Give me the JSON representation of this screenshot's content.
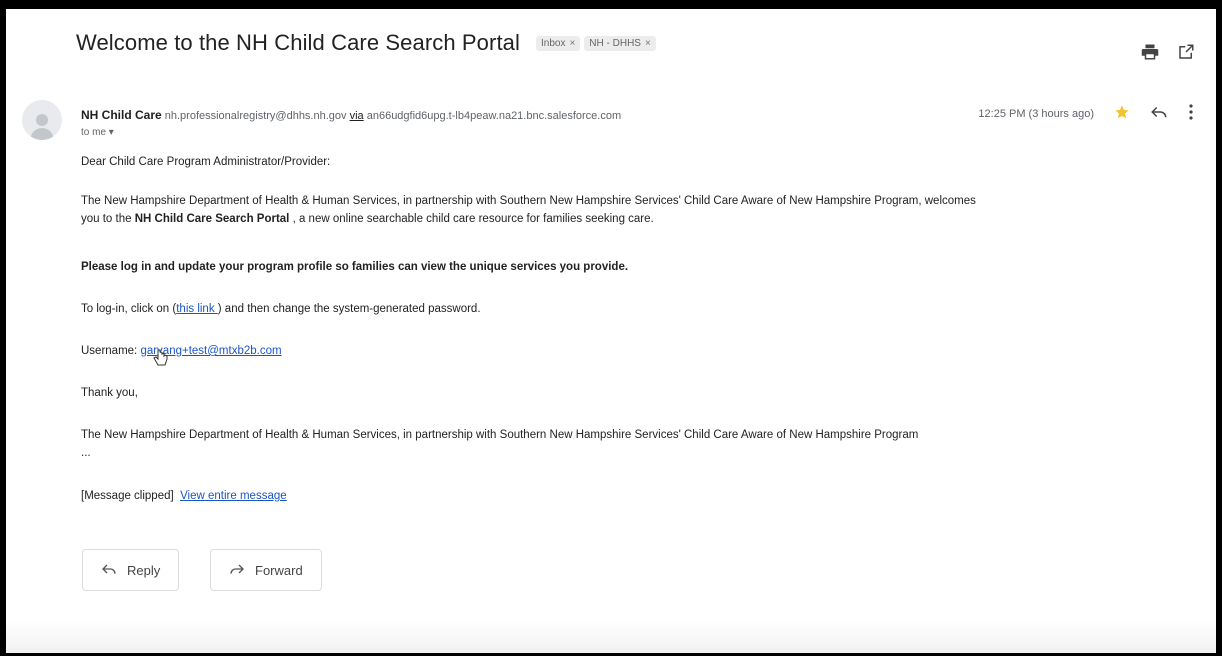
{
  "email": {
    "subject": "Welcome to the NH Child Care Search Portal",
    "labels": [
      {
        "text": "Inbox",
        "close": "×"
      },
      {
        "text": "NH - DHHS",
        "close": "×"
      }
    ],
    "sender": {
      "name": "NH Child Care",
      "email": "nh.professionalregistry@dhhs.nh.gov",
      "via_word": "via",
      "via_address": "an66udgfid6upg.t-lb4peaw.na21.bnc.salesforce.com",
      "to": "to me"
    },
    "time": "12:25 PM (3 hours ago)",
    "body": {
      "greeting": "Dear Child Care Program Administrator/Provider:",
      "para1_a": "The New Hampshire Department of Health & Human Services, in partnership with Southern New Hampshire Services' Child Care Aware of New Hampshire Program, welcomes",
      "para1_b": "you to the ",
      "para1_bold": "NH Child Care Search Portal",
      "para1_c": " , a new online searchable child care resource for families seeking care.",
      "bold_line": "Please log in and update your program profile so families can view the unique services you provide.",
      "login_a": "To log-in, click on (",
      "login_link": "this link ",
      "login_b": ") and then change the system-generated password.",
      "username_label": "Username: ",
      "username_value": "garvang+test@mtxb2b.com",
      "thanks": "Thank you,",
      "signature": "The New Hampshire Department of Health & Human Services, in partnership with Southern New Hampshire Services' Child Care Aware of New Hampshire Program",
      "ellipsis": "...",
      "clipped": "[Message clipped]",
      "view_entire": "View entire message"
    }
  },
  "actions": {
    "reply": "Reply",
    "forward": "Forward"
  },
  "icons": [
    "print-icon",
    "open-new-window-icon",
    "avatar-icon",
    "star-icon",
    "reply-icon",
    "more-vert-icon",
    "forward-icon",
    "cursor-icon"
  ],
  "colors": {
    "star": "#f4c430",
    "link": "#1a55c8"
  }
}
